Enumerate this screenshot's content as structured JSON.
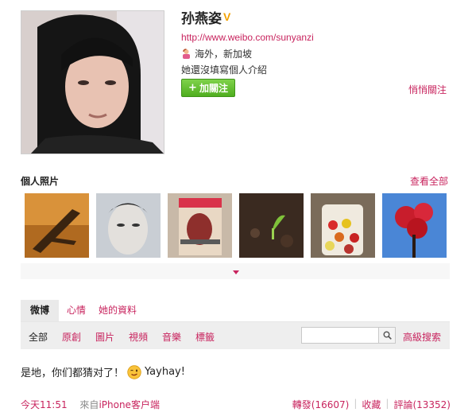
{
  "profile": {
    "name": "孙燕姿",
    "verified_mark": "V",
    "url": "http://www.weibo.com/sunyanzi",
    "location": "海外，新加坡",
    "bio": "她還沒填寫個人介紹",
    "follow_plus": "+",
    "follow_label": "加關注",
    "quiet_follow": "悄悄關注"
  },
  "photos": {
    "title": "個人照片",
    "view_all": "查看全部",
    "items": [
      "photo-branch",
      "photo-face-mask",
      "photo-nylon-magazine",
      "photo-sprout",
      "photo-candy-jar",
      "photo-red-flowers"
    ]
  },
  "tabs": [
    {
      "label": "微博"
    },
    {
      "label": "心情"
    },
    {
      "label": "她的資料"
    }
  ],
  "filters": [
    {
      "label": "全部"
    },
    {
      "label": "原創"
    },
    {
      "label": "圖片"
    },
    {
      "label": "視頻"
    },
    {
      "label": "音樂"
    },
    {
      "label": "標籤"
    }
  ],
  "search": {
    "value": "",
    "advanced": "高級搜索"
  },
  "post": {
    "text_before": "是地，你们都猜对了！",
    "text_after": "Yayhay!",
    "time": "今天11:51",
    "source_prefix": "來自",
    "source": "iPhone客户端",
    "repost": "轉發(16607)",
    "favorite": "收藏",
    "comment": "評論(13352)"
  },
  "icons": {
    "verified": "verified-badge-icon",
    "location": "person-icon",
    "search": "search-icon",
    "expand": "expand-arrow-icon",
    "emoji": "wink-emoji-icon"
  },
  "colors": {
    "link": "#c8245e",
    "follow_button": "#5cbc2b",
    "verified": "#f2a100"
  }
}
